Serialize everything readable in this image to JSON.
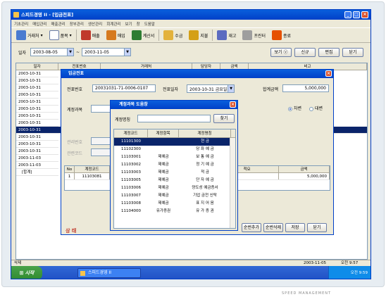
{
  "window": {
    "title": "스피드경영 II - [입금전표]"
  },
  "menu": [
    "기초관리",
    "매입관리",
    "매출관리",
    "장부관리",
    "생산관리",
    "회계관리",
    "보기",
    "창",
    "도움말"
  ],
  "toolbar": [
    {
      "label": "거래처",
      "icon": "people-icon"
    },
    {
      "label": "품목",
      "icon": "document-icon"
    },
    {
      "label": "매출",
      "icon": "house-icon"
    },
    {
      "label": "매입",
      "icon": "house-icon"
    },
    {
      "label": "계산서",
      "icon": "invoice-icon"
    },
    {
      "label": "수금",
      "icon": "money-icon"
    },
    {
      "label": "지불",
      "icon": "money-icon"
    },
    {
      "label": "재고",
      "icon": "stock-icon"
    },
    {
      "label": "프린터",
      "icon": "printer-icon"
    },
    {
      "label": "종료",
      "icon": "exit-icon"
    }
  ],
  "filter": {
    "date_label": "일자",
    "date_from": "2003-08-05",
    "date_to": "2003-11-05",
    "sep": "~",
    "buttons": [
      "보기 ⓥ",
      "신규",
      "편집",
      "닫기"
    ]
  },
  "grid": {
    "columns": [
      "일자",
      "전표번호",
      "거래처",
      "담당자",
      "금액",
      "비고"
    ],
    "rows": [
      "2003-10-31",
      "2003-10-31",
      "2003-10-31",
      "2003-10-31",
      "2003-10-31",
      "2003-10-31",
      "2003-10-31",
      "2003-10-31",
      "2003-10-31",
      "2003-10-31",
      "2003-10-31",
      "2003-10-31",
      "2003-11-03",
      "2003-11-03"
    ],
    "selected_index": 8,
    "total_label": "[합계]"
  },
  "dialog": {
    "title": "입금전표",
    "slip_no_label": "전표번호",
    "slip_no": "20031031-71-0006-0107",
    "date_label": "전표일자",
    "date": "2003-10-31 금요일",
    "total_label": "합계금액",
    "total": "5,000,000",
    "account_label": "계정과목",
    "radio_debit": "차변",
    "radio_credit": "대변",
    "manage_no_label": "관리번호",
    "manage_label": "관련코드",
    "table_columns": [
      "No",
      "계정코드",
      "적요",
      "금액"
    ],
    "table_row": {
      "no": "1",
      "code": "11103081",
      "name": "보",
      "memo": "전용",
      "amount": "5,000,000"
    },
    "status": "상 태",
    "buttons": [
      "순번추가",
      "순번삭제",
      "저장",
      "닫기"
    ]
  },
  "popup": {
    "title": "계정과목 도움창",
    "search_label": "계정명칭",
    "search_button": "찾기",
    "columns": [
      "계정코드",
      "계정항목",
      "계정명칭"
    ],
    "rows": [
      {
        "code": "11101300",
        "item": "",
        "name": "현            금"
      },
      {
        "code": "11102300",
        "item": "",
        "name": "당  좌  예  금"
      },
      {
        "code": "11103001",
        "item": "제예금",
        "name": "보  통  예  금"
      },
      {
        "code": "11103002",
        "item": "제예금",
        "name": "정  기  예  금"
      },
      {
        "code": "11103003",
        "item": "제예금",
        "name": "적            금"
      },
      {
        "code": "11103005",
        "item": "제예금",
        "name": "단  자  예  금"
      },
      {
        "code": "11103006",
        "item": "제예금",
        "name": "양도성 예금증서"
      },
      {
        "code": "11103007",
        "item": "제예금",
        "name": "기업 금전 신탁"
      },
      {
        "code": "11103008",
        "item": "제예금",
        "name": "표  지  어  음"
      },
      {
        "code": "11104000",
        "item": "유가증권",
        "name": "유  가  증  권"
      }
    ],
    "selected_index": 0
  },
  "status": {
    "left": "삭제",
    "date": "2003-11-05",
    "time": "오전 9:57"
  },
  "taskbar": {
    "start": "시작",
    "task": "스피드경영 II",
    "clock": "오전 9:59"
  },
  "caption": "SPEED MANAGEMENT",
  "colors": {
    "title_blue": "#0040c8",
    "selection": "#0a246a",
    "xp_face": "#ece9d8",
    "start_green": "#2f8a2f"
  }
}
